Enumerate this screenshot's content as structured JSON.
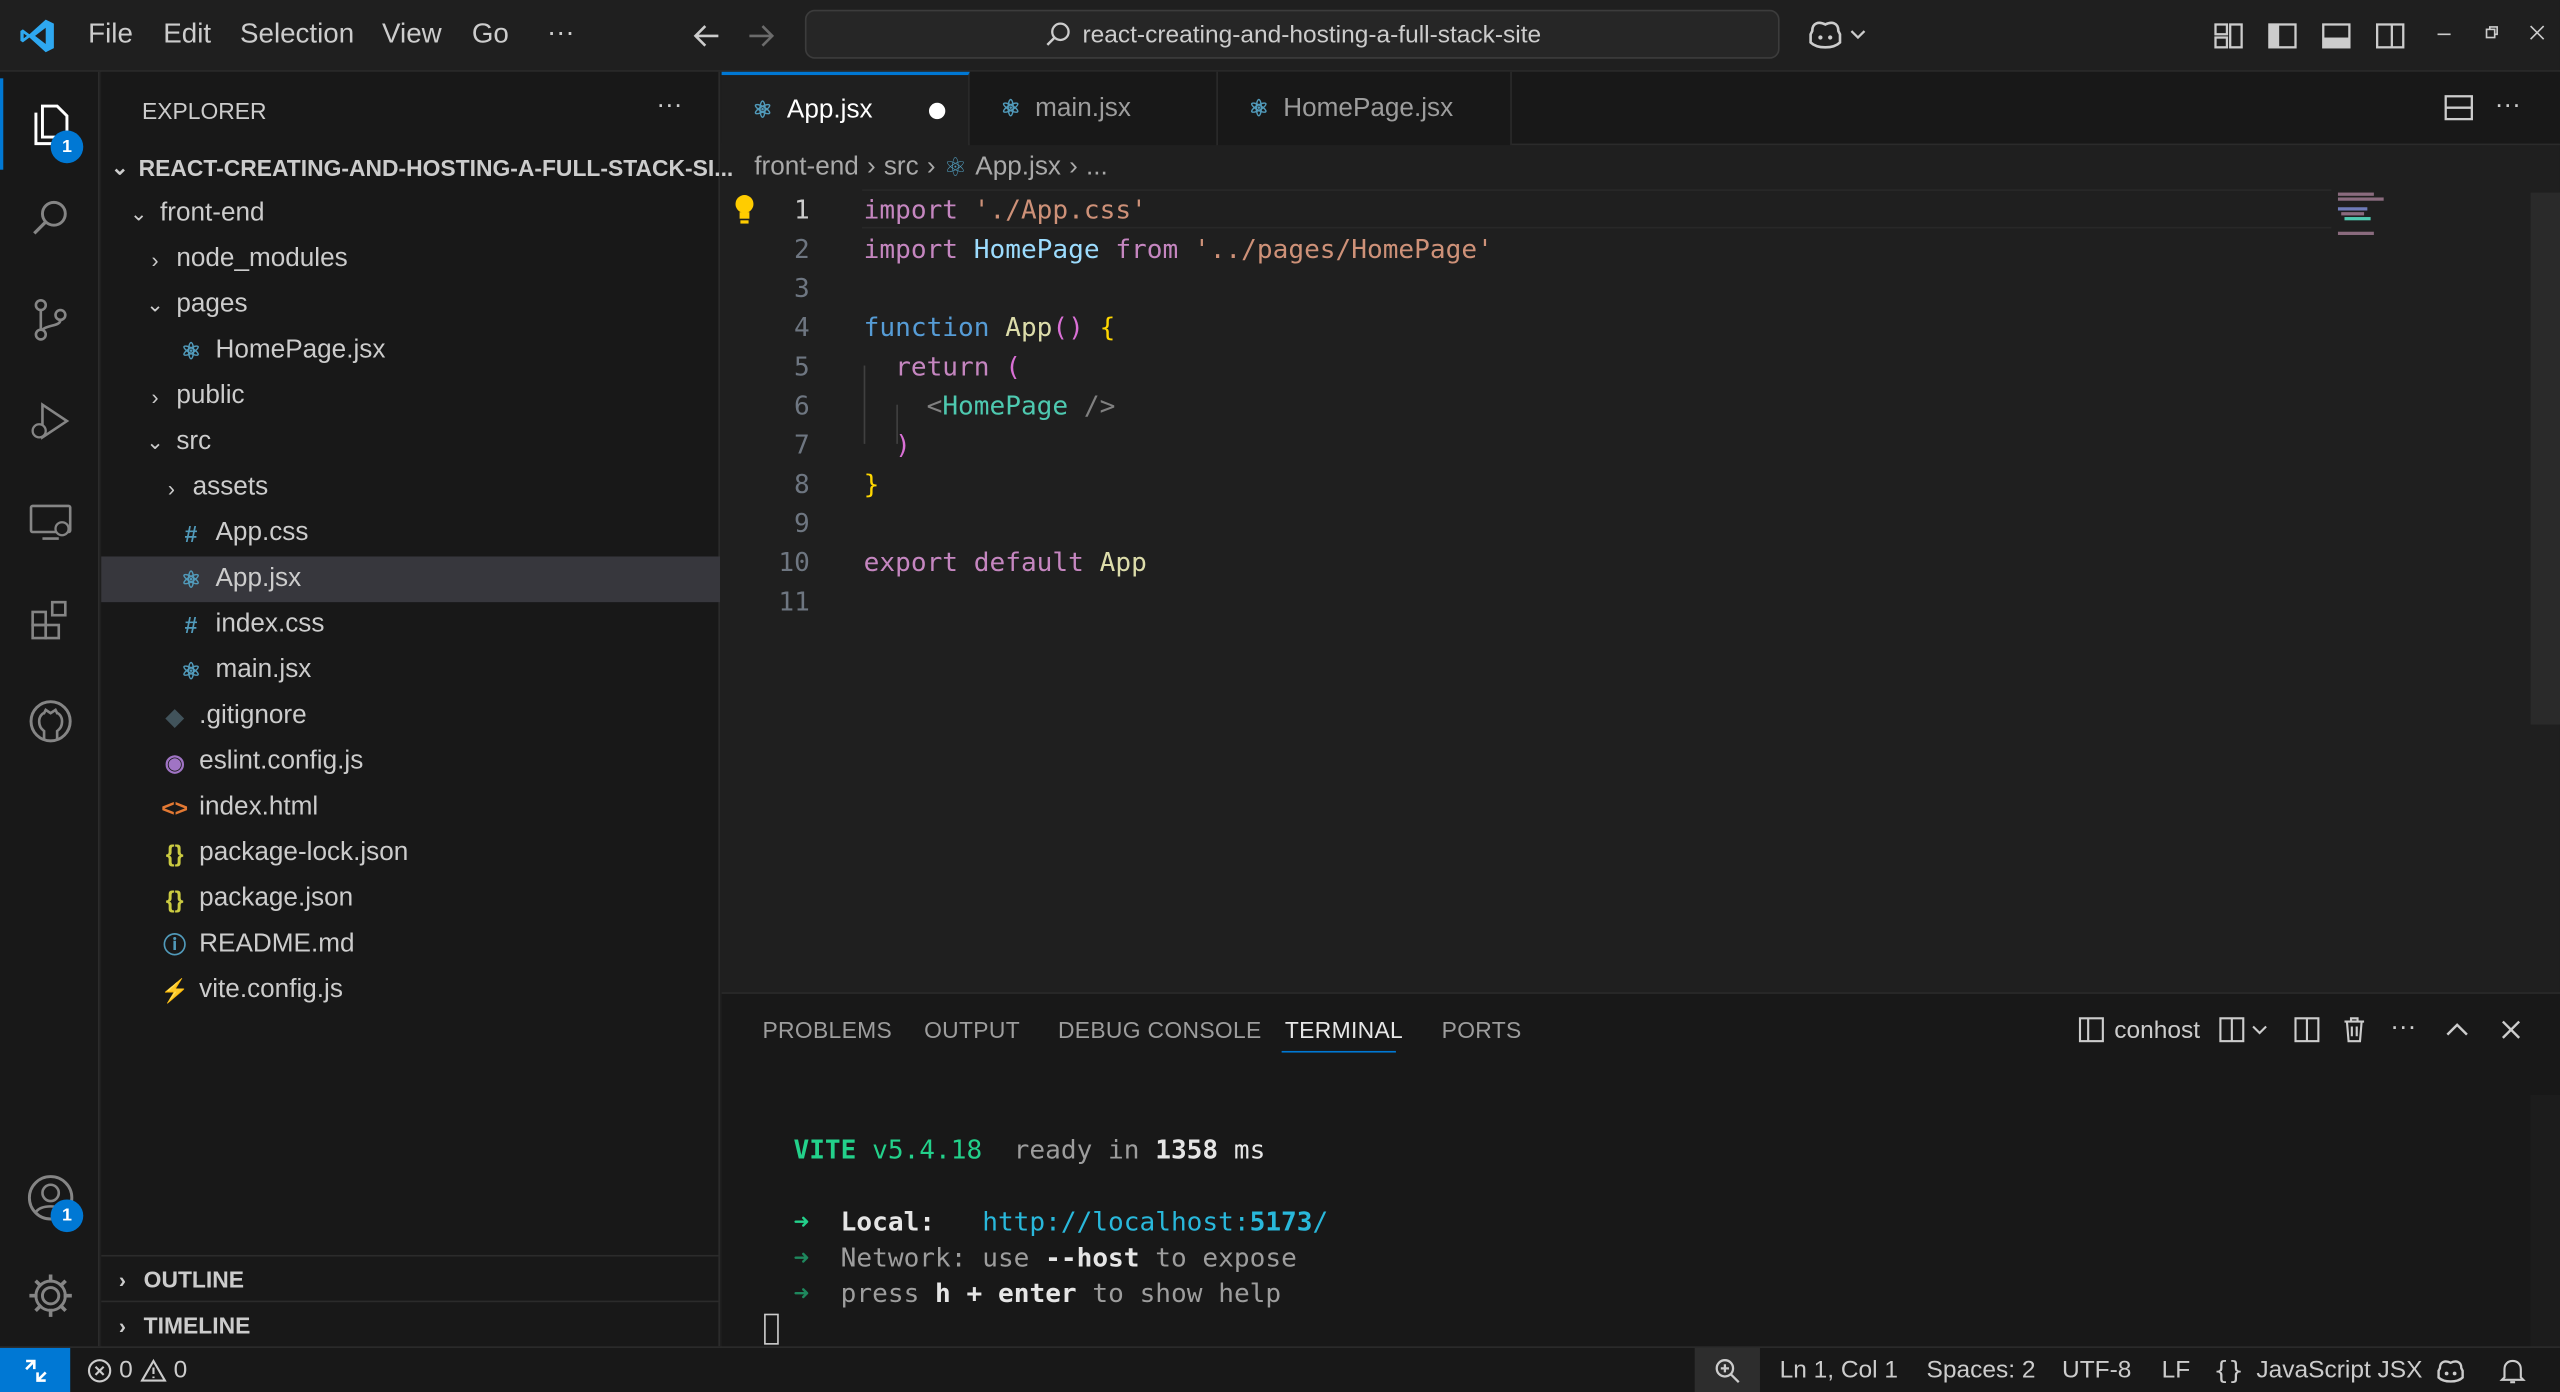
{
  "titlebar": {
    "menus": [
      "File",
      "Edit",
      "Selection",
      "View",
      "Go"
    ],
    "more": "···",
    "search_text": "react-creating-and-hosting-a-full-stack-site"
  },
  "activity": {
    "explorer_badge": "1",
    "accounts_badge": "1"
  },
  "sidebar": {
    "title": "EXPLORER",
    "more": "···",
    "root": "REACT-CREATING-AND-HOSTING-A-FULL-STACK-SI...",
    "items": [
      {
        "label": "front-end",
        "kind": "folder-open"
      },
      {
        "label": "node_modules",
        "kind": "folder"
      },
      {
        "label": "pages",
        "kind": "folder-open"
      },
      {
        "label": "HomePage.jsx",
        "kind": "react"
      },
      {
        "label": "public",
        "kind": "folder"
      },
      {
        "label": "src",
        "kind": "folder-open"
      },
      {
        "label": "assets",
        "kind": "folder"
      },
      {
        "label": "App.css",
        "kind": "css"
      },
      {
        "label": "App.jsx",
        "kind": "react"
      },
      {
        "label": "index.css",
        "kind": "css"
      },
      {
        "label": "main.jsx",
        "kind": "react"
      },
      {
        "label": ".gitignore",
        "kind": "git"
      },
      {
        "label": "eslint.config.js",
        "kind": "eslint"
      },
      {
        "label": "index.html",
        "kind": "html"
      },
      {
        "label": "package-lock.json",
        "kind": "json"
      },
      {
        "label": "package.json",
        "kind": "json"
      },
      {
        "label": "README.md",
        "kind": "info"
      },
      {
        "label": "vite.config.js",
        "kind": "vite"
      }
    ],
    "outline": "OUTLINE",
    "timeline": "TIMELINE"
  },
  "editor": {
    "tabs": [
      {
        "label": "App.jsx",
        "dirty": true
      },
      {
        "label": "main.jsx",
        "dirty": false
      },
      {
        "label": "HomePage.jsx",
        "dirty": false
      }
    ],
    "breadcrumb": [
      "front-end",
      "src",
      "App.jsx",
      "..."
    ],
    "line_numbers": [
      "1",
      "2",
      "3",
      "4",
      "5",
      "6",
      "7",
      "8",
      "9",
      "10",
      "11"
    ],
    "code": {
      "l1_kw": "import",
      "l1_str": "'./App.css'",
      "l2_kw": "import",
      "l2_id": "HomePage",
      "l2_from": "from",
      "l2_str": "'../pages/HomePage'",
      "l4_kw": "function",
      "l4_fn": "App",
      "l4_parens": "()",
      "l4_brace": "{",
      "l5_kw": "return",
      "l5_paren": "(",
      "l6_open": "<",
      "l6_tag": "HomePage",
      "l6_close": "/>",
      "l7_paren": ")",
      "l8_brace": "}",
      "l10_kw1": "export",
      "l10_kw2": "default",
      "l10_id": "App"
    }
  },
  "panel": {
    "tabs": [
      "PROBLEMS",
      "OUTPUT",
      "DEBUG CONSOLE",
      "TERMINAL",
      "PORTS"
    ],
    "terminal_name": "conhost",
    "terminal": {
      "vite": "VITE",
      "version": "v5.4.18",
      "ready": "ready in",
      "ms_value": "1358",
      "ms": "ms",
      "arrow": "➜",
      "local_label": "Local:",
      "local_url_a": "http://localhost:",
      "local_url_port": "5173",
      "local_url_b": "/",
      "network_label": "Network:",
      "network_use": "use",
      "network_flag": "--host",
      "network_to": "to expose",
      "press": "press",
      "key_h": "h",
      "plus": "+",
      "key_enter": "enter",
      "to_help": "to show help"
    }
  },
  "statusbar": {
    "errors": "0",
    "warnings": "0",
    "position": "Ln 1, Col 1",
    "spaces": "Spaces: 2",
    "encoding": "UTF-8",
    "eol": "LF",
    "language": "JavaScript JSX",
    "language_braces": "{}"
  },
  "colors": {
    "accent": "#0078d4",
    "keyword": "#c586c0",
    "string": "#ce9178",
    "function": "#dcdcaa",
    "terminal_green": "#23d18b",
    "terminal_cyan": "#29b8db"
  }
}
